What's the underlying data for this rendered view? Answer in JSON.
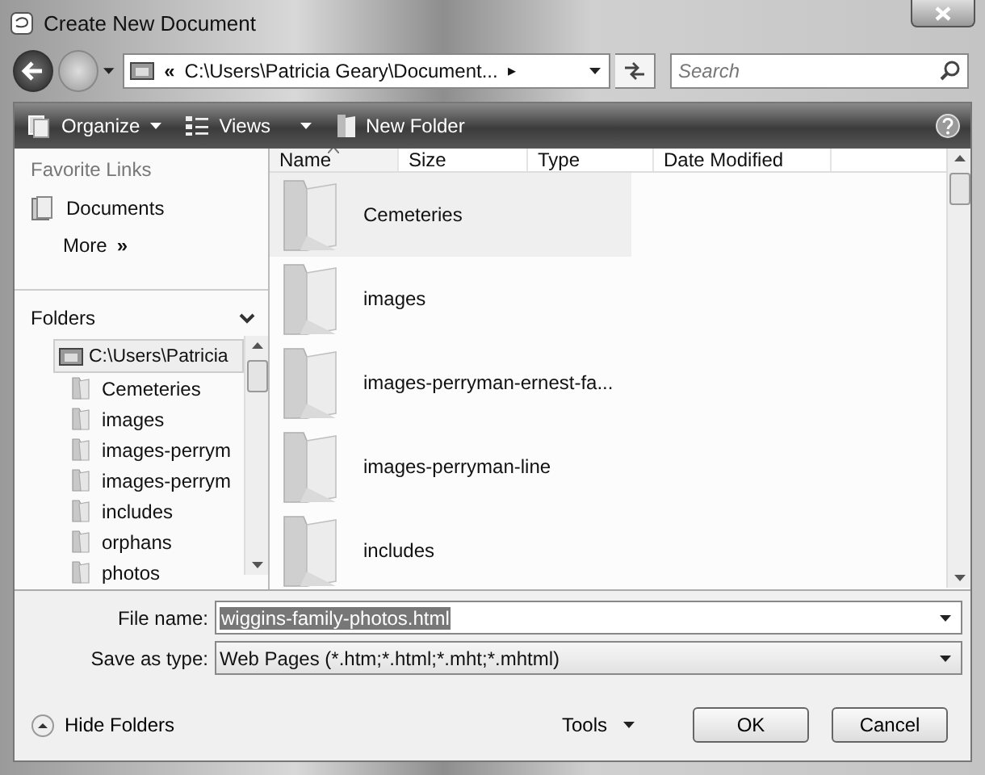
{
  "window": {
    "title": "Create New Document"
  },
  "address": {
    "path_prefix": "«",
    "path": "C:\\Users\\Patricia Geary\\Document...",
    "separator": "▸"
  },
  "search": {
    "placeholder": "Search"
  },
  "toolbar": {
    "items": [
      {
        "label": "Organize",
        "menu": true
      },
      {
        "label": "Views",
        "menu": true
      },
      {
        "label": "New Folder",
        "menu": false
      }
    ]
  },
  "favorite_links": {
    "title": "Favorite Links",
    "items": [
      {
        "label": "Documents"
      }
    ],
    "more": "More",
    "more_glyph": "»"
  },
  "folders": {
    "title": "Folders",
    "tree": [
      {
        "label": "C:\\Users\\Patricia",
        "selected": true,
        "children": [
          {
            "label": "Cemeteries",
            "selected": false
          },
          {
            "label": "images",
            "selected": false
          },
          {
            "label": "images-perrym",
            "selected": false
          },
          {
            "label": "images-perrym",
            "selected": false
          },
          {
            "label": "includes",
            "selected": false
          },
          {
            "label": "orphans",
            "selected": false
          },
          {
            "label": "photos",
            "selected": false
          }
        ]
      }
    ]
  },
  "file_list": {
    "columns": [
      "Name",
      "Size",
      "Type",
      "Date Modified"
    ],
    "items": [
      {
        "name": "Cemeteries",
        "selected": true
      },
      {
        "name": "images",
        "selected": false
      },
      {
        "name": "images-perryman-ernest-fa...",
        "selected": false
      },
      {
        "name": "images-perryman-line",
        "selected": false
      },
      {
        "name": "includes",
        "selected": false
      }
    ]
  },
  "file_name": {
    "label": "File name:",
    "value": "wiggins-family-photos.html"
  },
  "save_as_type": {
    "label": "Save as type:",
    "value": "Web Pages (*.htm;*.html;*.mht;*.mhtml)"
  },
  "footer": {
    "hide_folders": "Hide Folders",
    "tools": "Tools",
    "buttons": [
      "OK",
      "Cancel"
    ]
  }
}
